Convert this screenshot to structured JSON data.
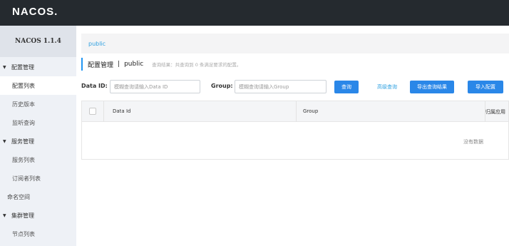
{
  "header": {
    "logo": "NACOS."
  },
  "sidebar": {
    "version": "NACOS 1.1.4",
    "items": [
      {
        "label": "配置管理",
        "type": "group"
      },
      {
        "label": "配置列表",
        "type": "sub",
        "active": true
      },
      {
        "label": "历史版本",
        "type": "sub"
      },
      {
        "label": "监听查询",
        "type": "sub"
      },
      {
        "label": "服务管理",
        "type": "group"
      },
      {
        "label": "服务列表",
        "type": "sub"
      },
      {
        "label": "订阅者列表",
        "type": "sub"
      },
      {
        "label": "命名空间",
        "type": "plain"
      },
      {
        "label": "集群管理",
        "type": "group"
      },
      {
        "label": "节点列表",
        "type": "sub"
      }
    ]
  },
  "breadcrumb": {
    "namespace": "public"
  },
  "page": {
    "title": "配置管理",
    "separator": "|",
    "namespace": "public",
    "result_text": "查询结果：共查询到 0 条满足要求的配置。"
  },
  "filters": {
    "data_id_label": "Data ID:",
    "data_id_placeholder": "模糊查询请输入Data ID",
    "group_label": "Group:",
    "group_placeholder": "模糊查询请输入Group"
  },
  "buttons": {
    "query": "查询",
    "advanced_query": "高级查询",
    "export": "导出查询结果",
    "import": "导入配置"
  },
  "table": {
    "columns": [
      "Data Id",
      "Group",
      "归属应用"
    ],
    "empty_text": "没有数据"
  },
  "colors": {
    "accent": "#2a87e8",
    "topbar": "#252a2f",
    "link": "#2ea0e0"
  }
}
